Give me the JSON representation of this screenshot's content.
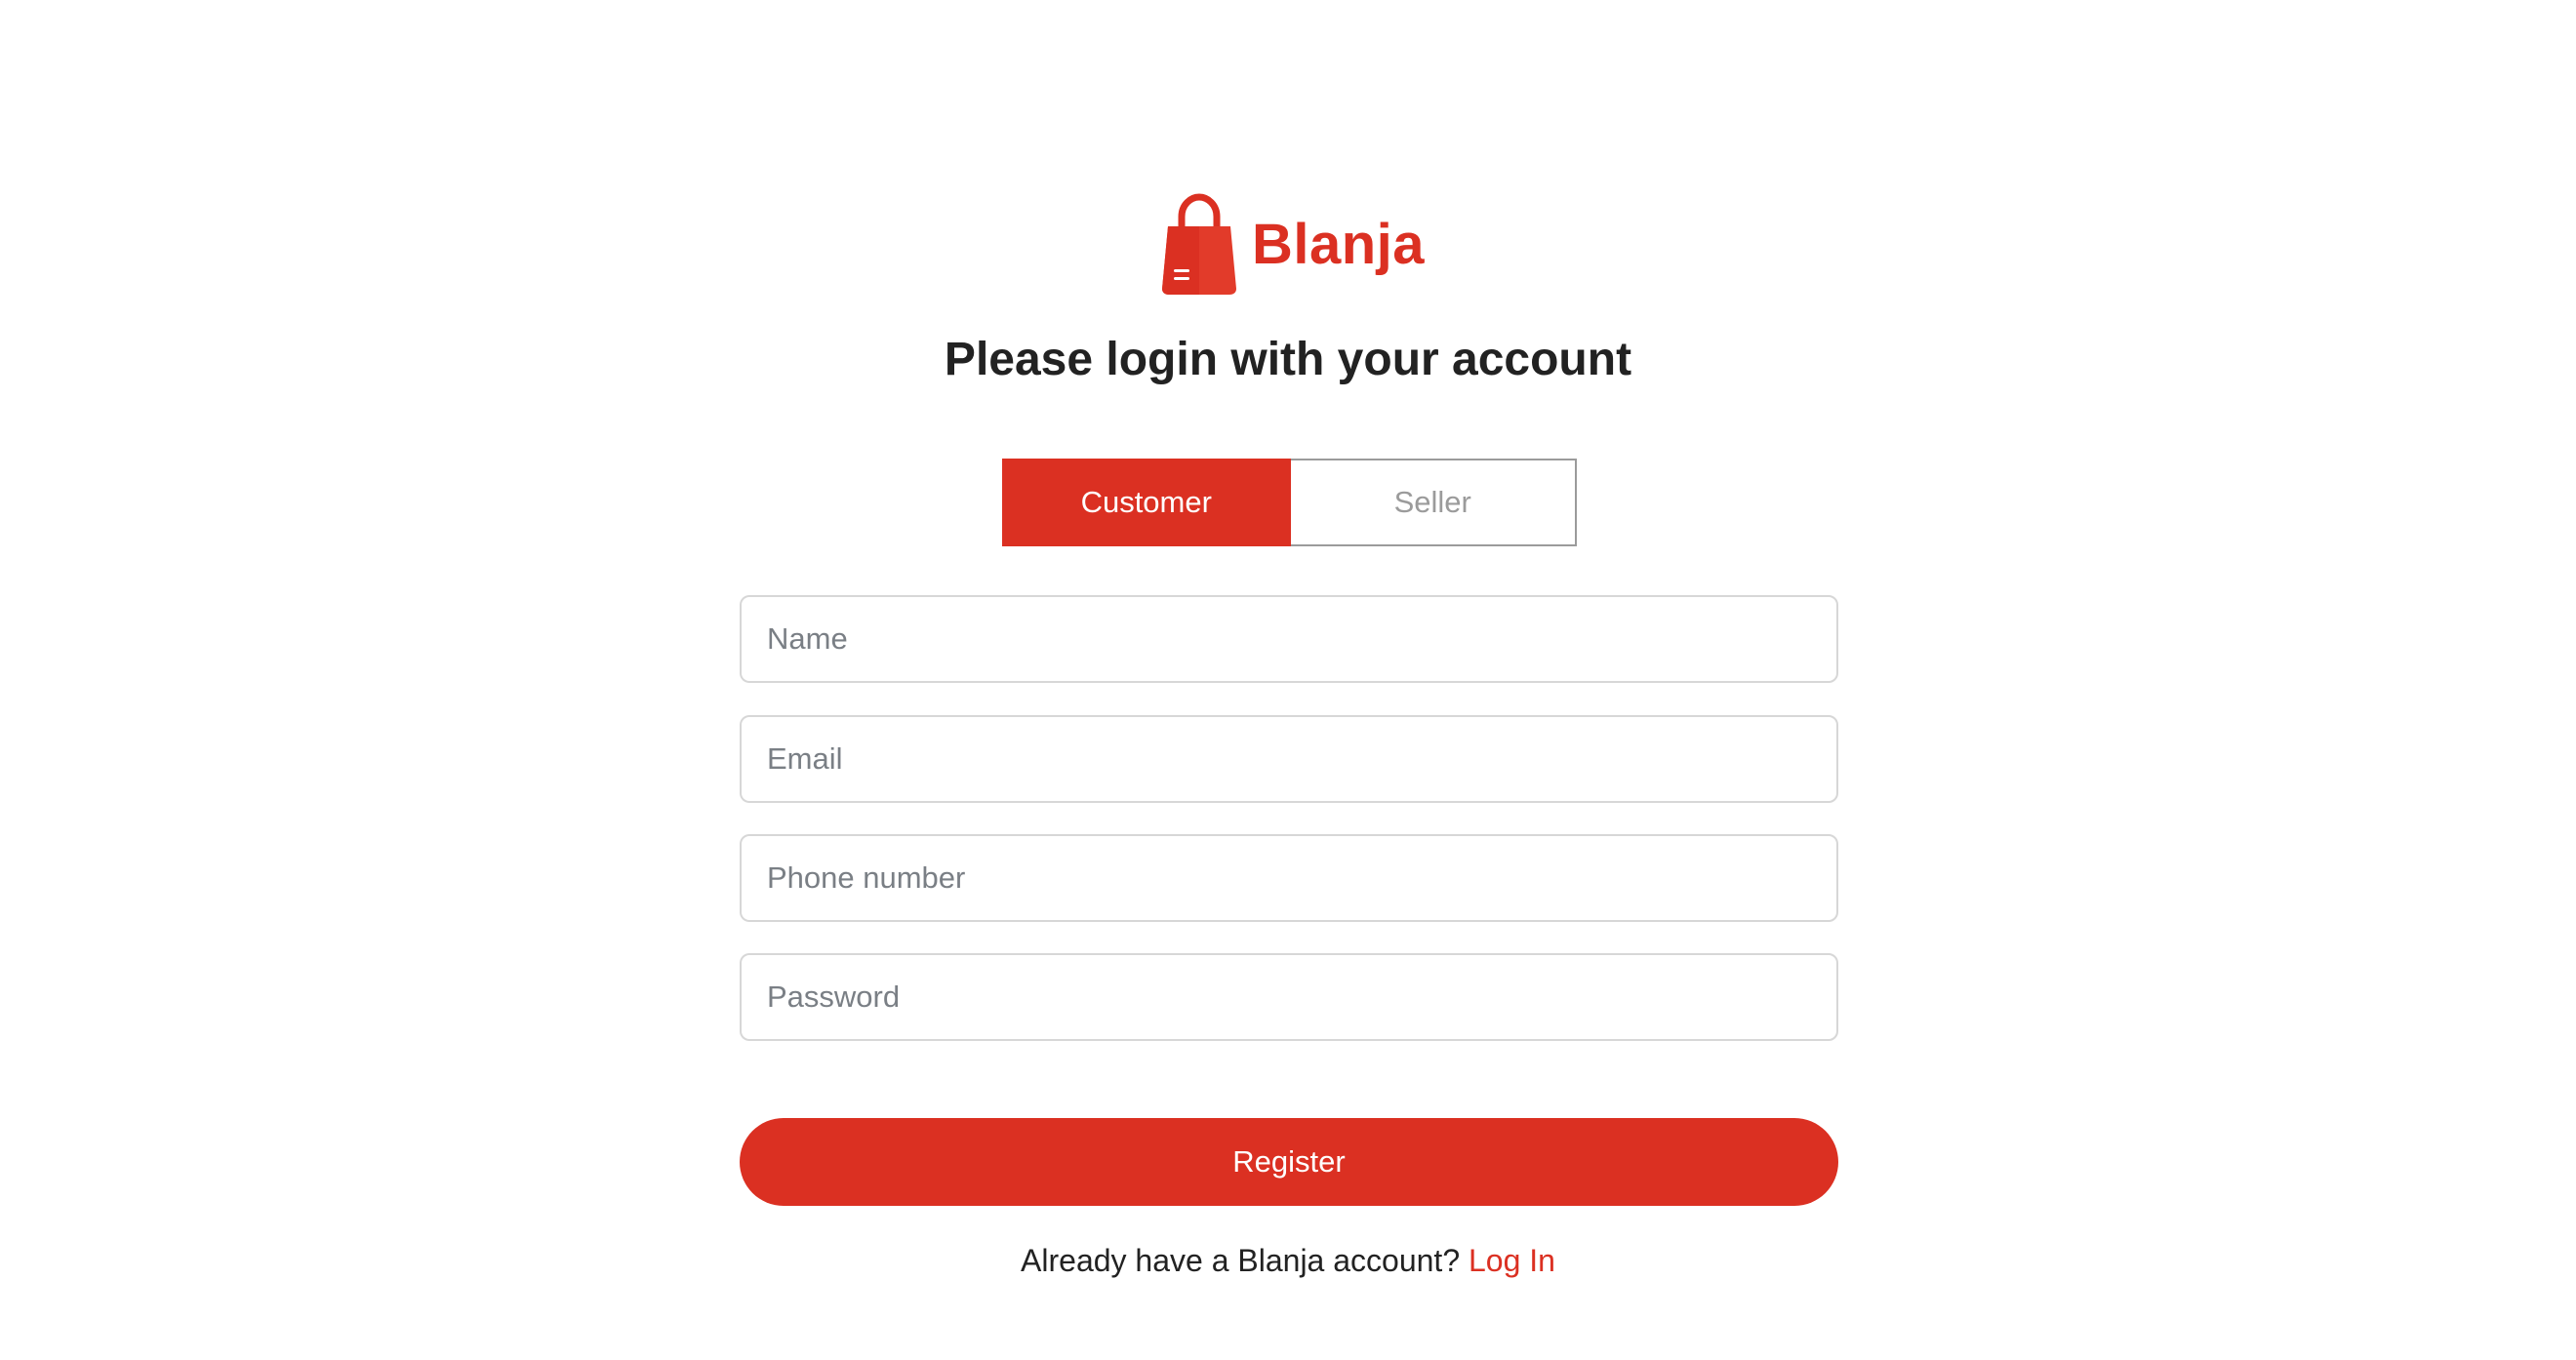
{
  "brand": {
    "name": "Blanja",
    "logo_icon": "shopping-bag-icon",
    "color": "#db3022"
  },
  "title": "Please login with your account",
  "role_toggle": {
    "options": [
      "Customer",
      "Seller"
    ],
    "selected": "Customer"
  },
  "form": {
    "name_placeholder": "Name",
    "email_placeholder": "Email",
    "phone_placeholder": "Phone number",
    "password_placeholder": "Password",
    "submit_label": "Register"
  },
  "footer": {
    "prompt": "Already have a Blanja account?",
    "link_label": "Log In"
  },
  "colors": {
    "accent": "#db3022",
    "text": "#222222",
    "border": "#d7d7d7",
    "inactive": "#9b9b9b"
  }
}
